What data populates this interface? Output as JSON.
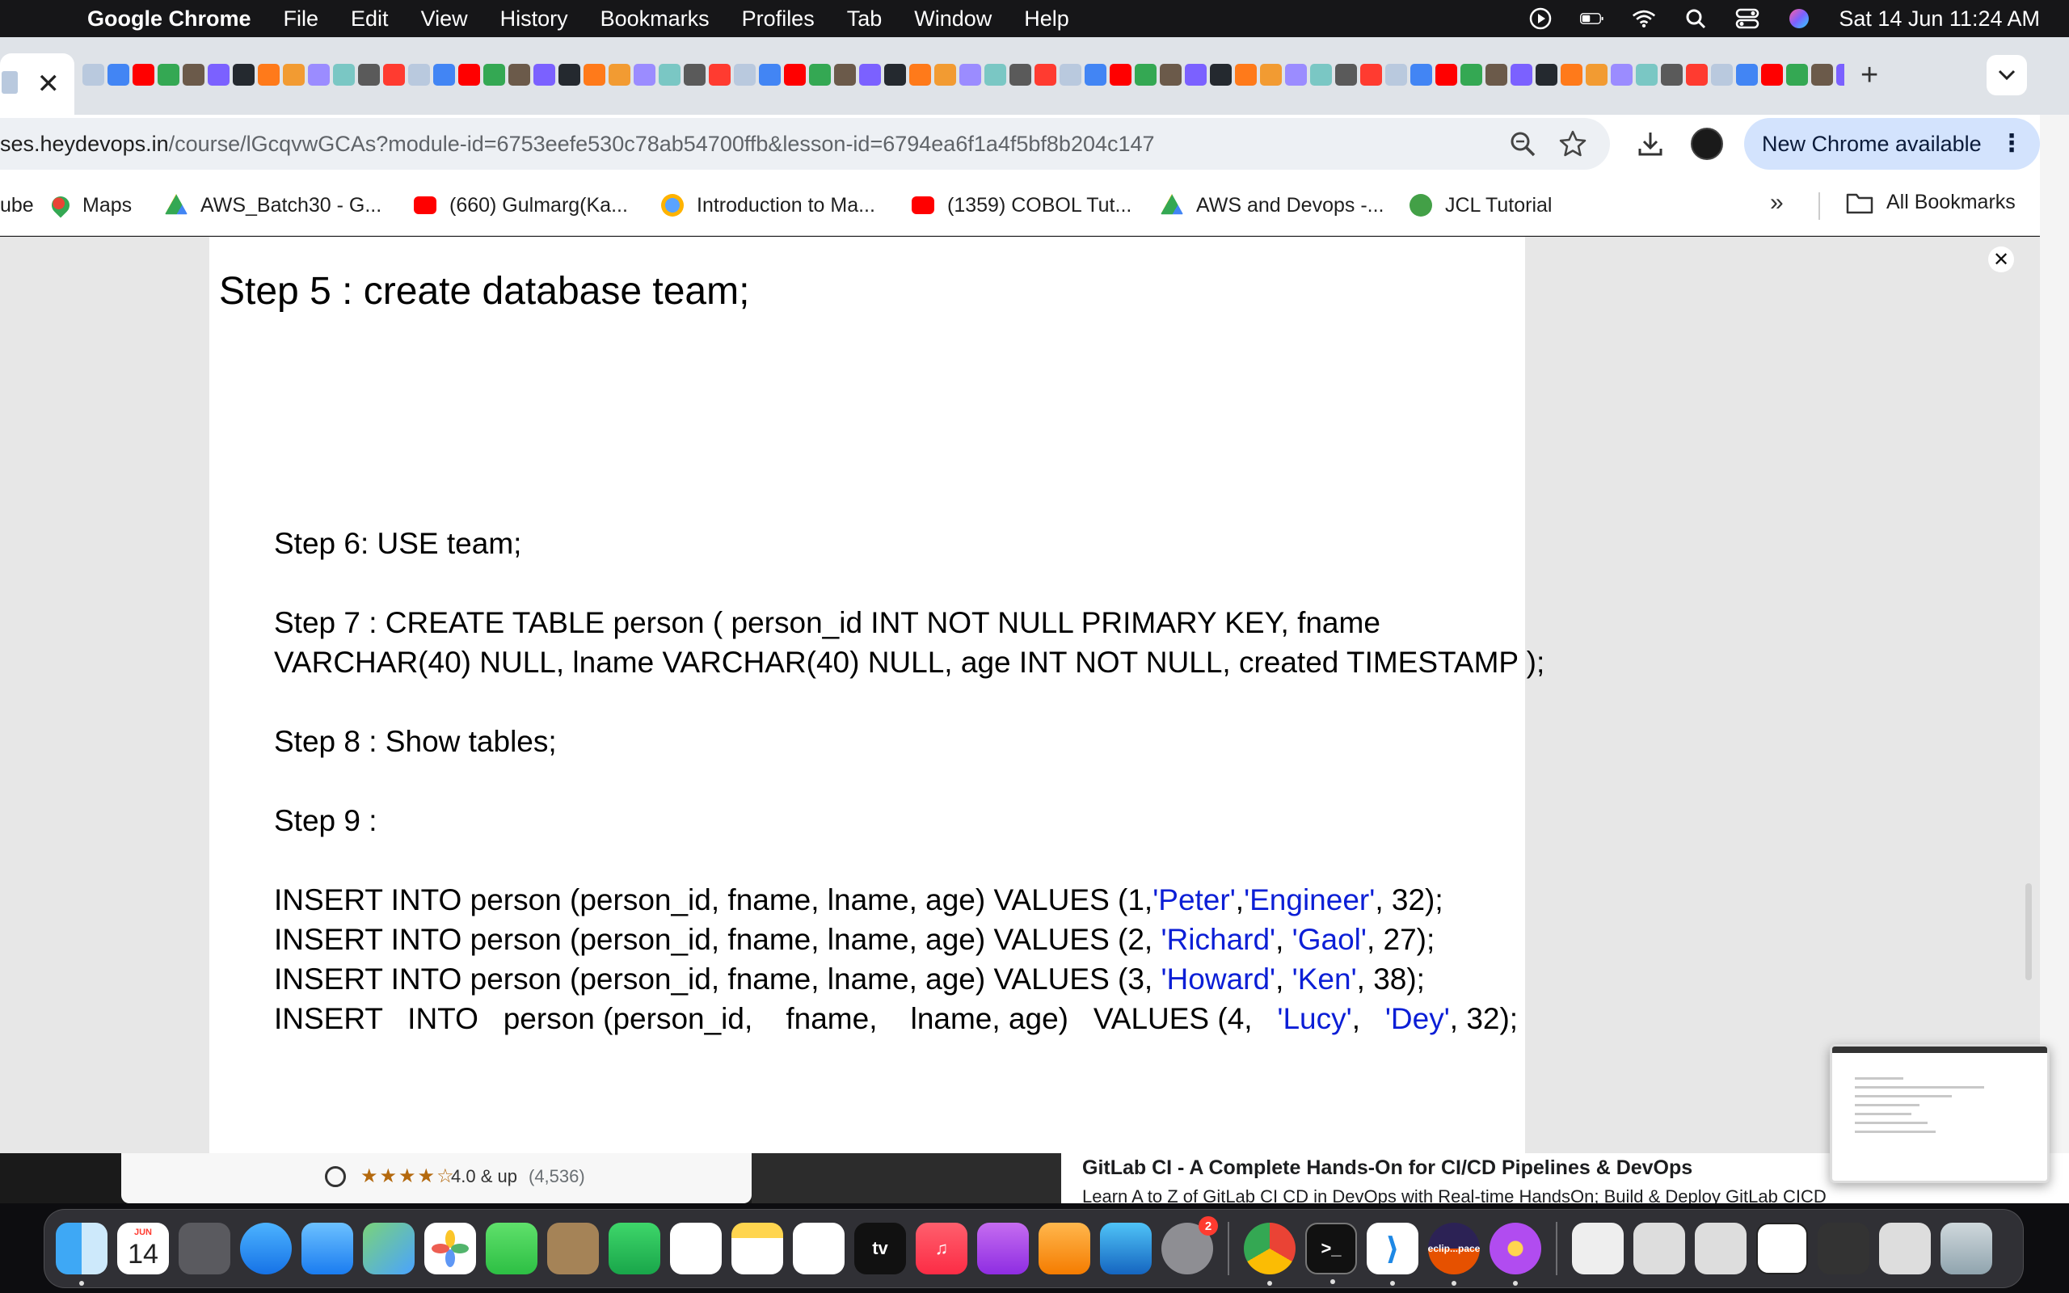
{
  "menubar": {
    "app_name": "Google Chrome",
    "items": [
      "File",
      "Edit",
      "View",
      "History",
      "Bookmarks",
      "Profiles",
      "Tab",
      "Window",
      "Help"
    ],
    "clock": "Sat 14 Jun  11:24 AM"
  },
  "tabs": {
    "active_close": "✕",
    "new_tab": "+",
    "search_tabs": "⌄"
  },
  "toolbar": {
    "url_host": "ses.heydevops.in",
    "url_path": "/course/lGcqvwGCAs?module-id=6753eefe530c78ab54700ffb&lesson-id=6794ea6f1a4f5bf8b204c147",
    "update_label": "New Chrome available",
    "menu_dots": "⋮"
  },
  "bookmarks": {
    "items": [
      {
        "label": "ube",
        "icon": "youtube-icon"
      },
      {
        "label": "Maps",
        "icon": "maps-icon"
      },
      {
        "label": "AWS_Batch30 - G...",
        "icon": "google-drive-icon"
      },
      {
        "label": "(660) Gulmarg(Ka...",
        "icon": "youtube-icon"
      },
      {
        "label": "Introduction to Ma...",
        "icon": "web-icon"
      },
      {
        "label": "(1359) COBOL Tut...",
        "icon": "youtube-icon"
      },
      {
        "label": "AWS and Devops -...",
        "icon": "google-drive-icon"
      },
      {
        "label": "JCL Tutorial",
        "icon": "jcl-icon"
      }
    ],
    "more": "»",
    "all_bookmarks": "All Bookmarks"
  },
  "document": {
    "step5": "Step 5 : create database team;",
    "step6": "Step 6: USE team;",
    "step7_line1": "Step 7 : CREATE TABLE person ( person_id INT NOT NULL PRIMARY KEY, fname",
    "step7_line2": "VARCHAR(40) NULL, lname VARCHAR(40) NULL, age INT NOT NULL, created TIMESTAMP );",
    "step8": "Step 8 : Show tables;",
    "step9": "Step 9 :",
    "inserts": [
      {
        "prefix": "INSERT INTO person (person_id,  fname,  lname, age) VALUES (1,",
        "fname": "'Peter'",
        "sep": ",",
        "lname": "'Engineer'",
        "suffix": ", 32);"
      },
      {
        "prefix": "INSERT INTO person (person_id,  fname,  lname, age) VALUES (2, ",
        "fname": "'Richard'",
        "sep": ", ",
        "lname": "'Gaol'",
        "suffix": ", 27);"
      },
      {
        "prefix": "INSERT INTO person (person_id,  fname,  lname, age) VALUES (3, ",
        "fname": "'Howard'",
        "sep": ", ",
        "lname": "'Ken'",
        "suffix": ", 38);"
      },
      {
        "prefix": "INSERT   INTO   person (person_id,    fname,    lname, age)   VALUES (4,   ",
        "fname": "'Lucy'",
        "sep": ",   ",
        "lname": "'Dey'",
        "suffix": ", 32);"
      }
    ]
  },
  "course_strip": {
    "stars": "★★★★☆",
    "rating": "4.0 & up",
    "count": "(4,536)",
    "title": "GitLab CI - A Complete Hands-On for CI/CD Pipelines & DevOps",
    "subtitle": "Learn A to Z of GitLab CI CD in DevOps with Real-time HandsOn; Build & Deploy GitLab CICD"
  },
  "dock": {
    "calendar_month": "JUN",
    "calendar_day": "14",
    "settings_badge": "2",
    "eclipse_label": "eclip...pace",
    "tv_label": "tv"
  },
  "colors": {
    "string_literal": "#0b1ed6",
    "update_pill": "#d3e3fd",
    "menubar": "#161618"
  }
}
